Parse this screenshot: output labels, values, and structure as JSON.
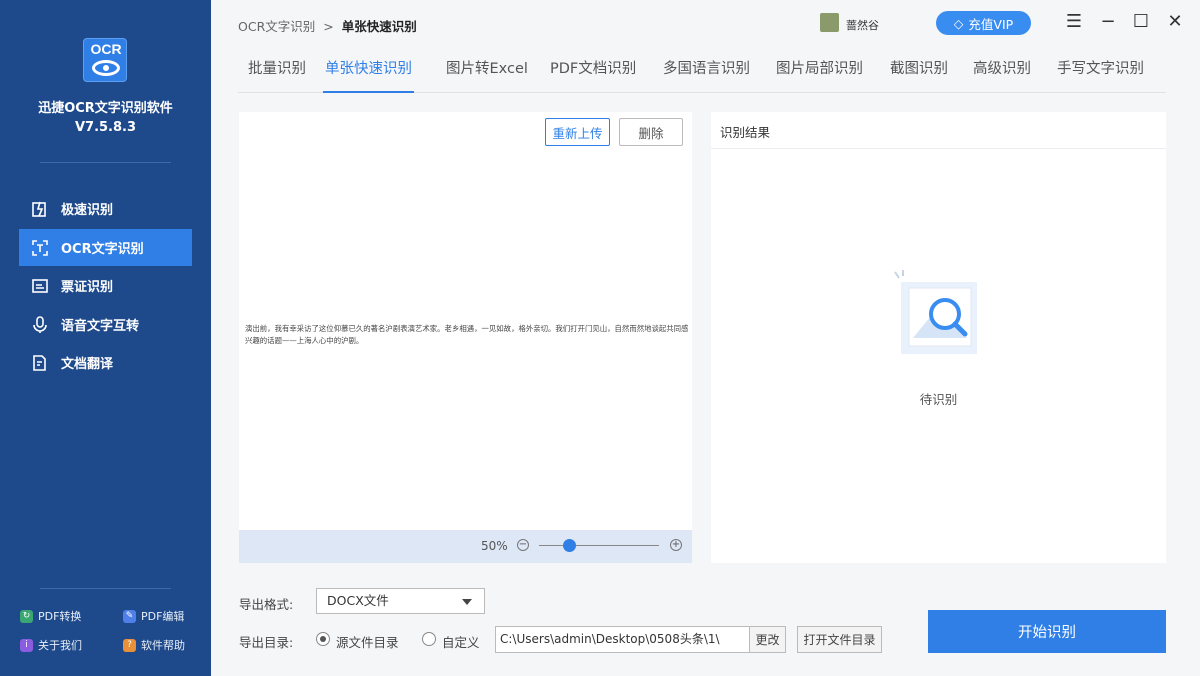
{
  "app": {
    "logo_text": "OCR",
    "name": "迅捷OCR文字识别软件",
    "version": "V7.5.8.3"
  },
  "sidebar": {
    "items": [
      {
        "label": "极速识别",
        "icon": "lightning-doc-icon"
      },
      {
        "label": "OCR文字识别",
        "icon": "scan-text-icon",
        "active": true
      },
      {
        "label": "票证识别",
        "icon": "ticket-icon"
      },
      {
        "label": "语音文字互转",
        "icon": "microphone-icon"
      },
      {
        "label": "文档翻译",
        "icon": "translate-doc-icon"
      }
    ],
    "bottom_links": [
      {
        "label": "PDF转换",
        "icon": "pdf-convert-icon",
        "color": "#3aa672"
      },
      {
        "label": "PDF编辑",
        "icon": "pdf-edit-icon",
        "color": "#4f7fe8"
      },
      {
        "label": "关于我们",
        "icon": "about-icon",
        "color": "#8a5de0"
      },
      {
        "label": "软件帮助",
        "icon": "help-icon",
        "color": "#e8903a"
      }
    ]
  },
  "header": {
    "breadcrumb_root": "OCR文字识别",
    "breadcrumb_sep": ">",
    "breadcrumb_current": "单张快速识别",
    "username": "蔷然谷",
    "vip_label": "充值VIP"
  },
  "tabs": [
    {
      "label": "批量识别"
    },
    {
      "label": "单张快速识别",
      "active": true
    },
    {
      "label": "图片转Excel"
    },
    {
      "label": "PDF文档识别"
    },
    {
      "label": "多国语言识别"
    },
    {
      "label": "图片局部识别"
    },
    {
      "label": "截图识别"
    },
    {
      "label": "高级识别"
    },
    {
      "label": "手写文字识别"
    }
  ],
  "preview": {
    "reupload_label": "重新上传",
    "delete_label": "删除",
    "document_text": "演出前，我有幸采访了这位仰慕已久的著名沪剧表演艺术家。老乡相遇，一见如故，格外亲切。我们打开门见山，自然而然地谈起共同感兴趣的话题——上海人心中的沪剧。",
    "zoom": "50%",
    "zoom_minus": "⊖",
    "zoom_plus": "⊕"
  },
  "result": {
    "title": "识别结果",
    "pending_label": "待识别"
  },
  "export": {
    "format_label": "导出格式:",
    "format_value": "DOCX文件",
    "dir_label": "导出目录:",
    "source_dir_label": "源文件目录",
    "custom_label": "自定义",
    "path_value": "C:\\Users\\admin\\Desktop\\0508头条\\1\\",
    "change_label": "更改",
    "open_dir_label": "打开文件目录",
    "start_label": "开始识别"
  },
  "colors": {
    "sidebar_bg": "#1e4a8c",
    "accent": "#2f7fe6"
  }
}
